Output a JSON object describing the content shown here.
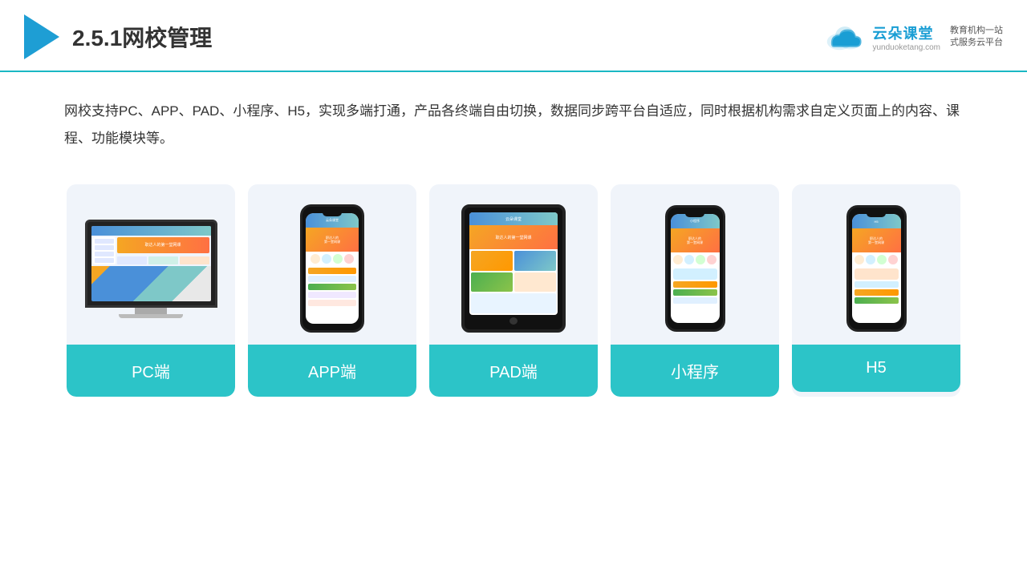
{
  "header": {
    "title": "2.5.1网校管理",
    "brand": {
      "name": "云朵课堂",
      "url": "yunduoketang.com",
      "slogan": "教育机构一站\n式服务云平台"
    }
  },
  "description": {
    "text": "网校支持PC、APP、PAD、小程序、H5，实现多端打通，产品各终端自由切换，数据同步跨平台自适应，同时根据机构需求自定义页面上的内容、课程、功能模块等。"
  },
  "cards": [
    {
      "id": "pc",
      "label": "PC端"
    },
    {
      "id": "app",
      "label": "APP端"
    },
    {
      "id": "pad",
      "label": "PAD端"
    },
    {
      "id": "miniprogram",
      "label": "小程序"
    },
    {
      "id": "h5",
      "label": "H5"
    }
  ],
  "colors": {
    "teal": "#2cc4c8",
    "blue": "#1a9ed4",
    "accent": "#1ab8c4",
    "text": "#333333"
  }
}
